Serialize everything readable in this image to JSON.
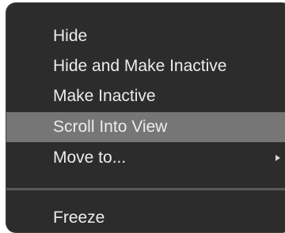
{
  "menu": {
    "items": [
      {
        "label": "Hide"
      },
      {
        "label": "Hide and Make Inactive"
      },
      {
        "label": "Make Inactive"
      },
      {
        "label": "Scroll Into View",
        "highlighted": true
      },
      {
        "label": "Move to...",
        "has_submenu": true
      },
      {
        "label": "Freeze"
      }
    ],
    "highlight_color": "#767676",
    "background_color": "#2c2c2c"
  }
}
